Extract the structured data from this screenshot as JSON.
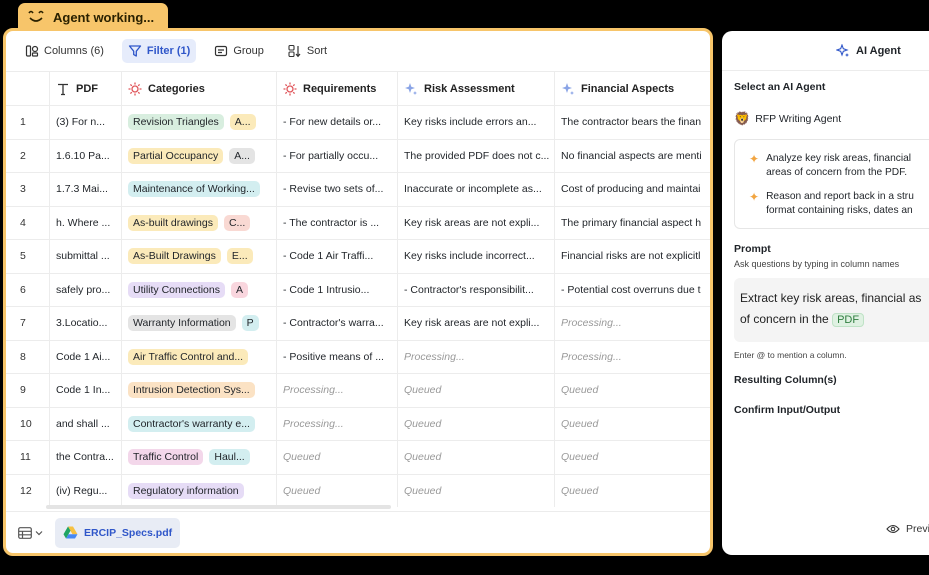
{
  "agent_status": {
    "label": "Agent working..."
  },
  "toolbar": [
    {
      "label": "Columns (6)",
      "icon": "columns-icon",
      "active": false
    },
    {
      "label": "Filter (1)",
      "icon": "filter-icon",
      "active": true
    },
    {
      "label": "Group",
      "icon": "group-icon",
      "active": false
    },
    {
      "label": "Sort",
      "icon": "sort-icon",
      "active": false
    }
  ],
  "columns": [
    {
      "label": "PDF",
      "icon": "text-icon"
    },
    {
      "label": "Categories",
      "icon": "sparkle-sun-icon"
    },
    {
      "label": "Requirements",
      "icon": "sparkle-sun-icon"
    },
    {
      "label": "Risk Assessment",
      "icon": "ai-sparkle-icon"
    },
    {
      "label": "Financial Aspects",
      "icon": "ai-sparkle-icon"
    }
  ],
  "rows": [
    {
      "num": "1",
      "pdf": "(3) For n...",
      "cats": [
        {
          "t": "Revision Triangles",
          "c": "#d8eedf"
        },
        {
          "t": "A...",
          "c": "#fbeaba"
        }
      ],
      "req": "- For new details or...",
      "risk": "Key risks include errors an...",
      "fin": "The contractor bears the finan"
    },
    {
      "num": "2",
      "pdf": "1.6.10 Pa...",
      "cats": [
        {
          "t": "Partial Occupancy",
          "c": "#fbeaba"
        },
        {
          "t": "A...",
          "c": "#e4e4e4"
        }
      ],
      "req": "- For partially occu...",
      "risk": "The provided PDF does not c...",
      "fin": "No financial aspects are menti"
    },
    {
      "num": "3",
      "pdf": "1.7.3 Mai...",
      "cats": [
        {
          "t": "Maintenance of Working...",
          "c": "#d3eef0"
        }
      ],
      "req": "- Revise two sets of...",
      "risk": "Inaccurate or incomplete as...",
      "fin": "Cost of producing and maintai"
    },
    {
      "num": "4",
      "pdf": "h. Where ...",
      "cats": [
        {
          "t": "As-built drawings",
          "c": "#fbeaba"
        },
        {
          "t": "C...",
          "c": "#f9d9d3"
        }
      ],
      "req": "- The contractor is ...",
      "risk": "Key risk areas are not expli...",
      "fin": "The primary financial aspect h"
    },
    {
      "num": "5",
      "pdf": "submittal ...",
      "cats": [
        {
          "t": "As-Built Drawings",
          "c": "#fbeaba"
        },
        {
          "t": "E...",
          "c": "#fbeaba"
        }
      ],
      "req": "- Code 1 Air Traffi...",
      "risk": "Key risks include incorrect...",
      "fin": "Financial risks are not explicitl"
    },
    {
      "num": "6",
      "pdf": "safely pro...",
      "cats": [
        {
          "t": "Utility Connections",
          "c": "#e6dcf6"
        },
        {
          "t": "A",
          "c": "#f9d6de"
        }
      ],
      "req": "- Code 1 Intrusio...",
      "risk": "- Contractor's responsibilit...",
      "fin": "- Potential cost overruns due t"
    },
    {
      "num": "7",
      "pdf": "3.Locatio...",
      "cats": [
        {
          "t": "Warranty Information",
          "c": "#e4e4e4"
        },
        {
          "t": "P",
          "c": "#d3eef0"
        }
      ],
      "req": "- Contractor's warra...",
      "risk": "Key risk areas are not expli...",
      "fin": "Processing..."
    },
    {
      "num": "8",
      "pdf": "Code 1 Ai...",
      "cats": [
        {
          "t": "Air Traffic Control and...",
          "c": "#fbeaba"
        }
      ],
      "req": "- Positive means of ...",
      "risk": "Processing...",
      "fin": "Processing..."
    },
    {
      "num": "9",
      "pdf": "Code 1 In...",
      "cats": [
        {
          "t": "Intrusion Detection Sys...",
          "c": "#fbe2c4"
        }
      ],
      "req": "Processing...",
      "risk": "Queued",
      "fin": "Queued"
    },
    {
      "num": "10",
      "pdf": "and shall ...",
      "cats": [
        {
          "t": "Contractor's warranty e...",
          "c": "#d3eef0"
        }
      ],
      "req": "Processing...",
      "risk": "Queued",
      "fin": "Queued"
    },
    {
      "num": "11",
      "pdf": "the Contra...",
      "cats": [
        {
          "t": "Traffic Control",
          "c": "#f3d7ea"
        },
        {
          "t": "Haul...",
          "c": "#d3eef0"
        }
      ],
      "req": "Queued",
      "risk": "Queued",
      "fin": "Queued"
    },
    {
      "num": "12",
      "pdf": "(iv) Regu...",
      "cats": [
        {
          "t": "Regulatory information",
          "c": "#e6dcf6"
        }
      ],
      "req": "Queued",
      "risk": "Queued",
      "fin": "Queued"
    }
  ],
  "footer": {
    "file_name": "ERCIP_Specs.pdf"
  },
  "side_panel": {
    "title": "AI Agent",
    "select_label": "Select an AI Agent",
    "agent_name": "RFP Writing Agent",
    "steps": [
      {
        "line1": "Analyze key risk areas, financial",
        "line2": "areas of concern from the PDF."
      },
      {
        "line1": "Reason and report back in a stru",
        "line2": "format containing risks, dates an"
      }
    ],
    "prompt_label": "Prompt",
    "prompt_hint": "Ask questions by typing in column names",
    "prompt_line1": "Extract key risk areas, financial as",
    "prompt_line2_prefix": "of concern in the",
    "prompt_tag": "PDF",
    "mention_hint": "Enter @ to mention a column.",
    "resulting_label": "Resulting Column(s)",
    "confirm_label": "Confirm Input/Output",
    "preview_label": "Previ"
  }
}
